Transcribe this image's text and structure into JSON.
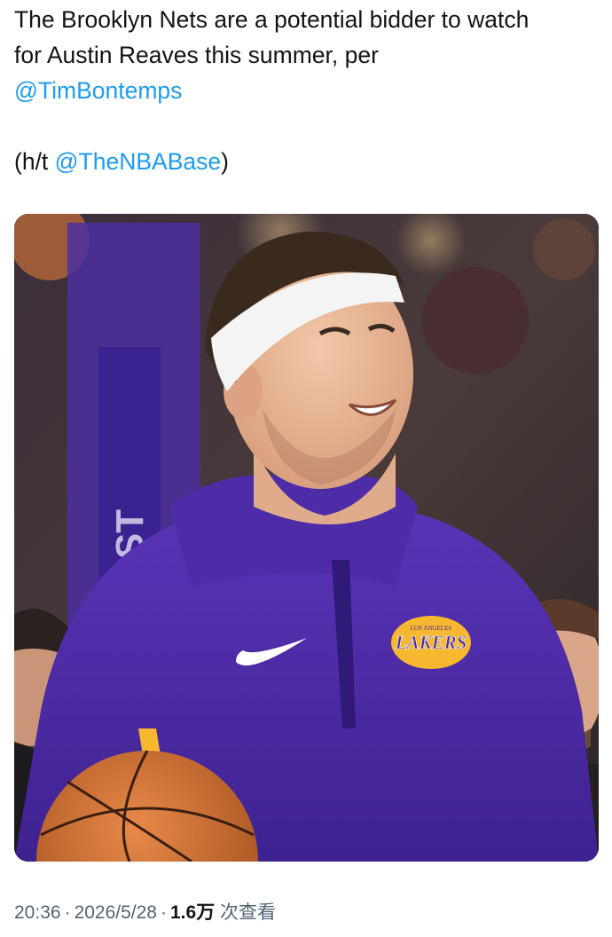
{
  "tweet": {
    "text_line1": "The Brooklyn Nets are a potential bidder to watch",
    "text_line2": "for Austin Reaves this summer, per",
    "mention1": "@TimBontemps",
    "hat_tip_prefix": "(h/t ",
    "mention2": "@TheNBABase",
    "hat_tip_suffix": ")"
  },
  "media": {
    "jersey_logo_text": "LAKERS",
    "jersey_logo_small": "LOS ANGELES",
    "banner_text": "FIRST",
    "colors": {
      "jersey_purple": "#4b2a9e",
      "lakers_gold": "#f5b82e",
      "headband": "#f4f4f4",
      "ball_orange": "#d9762c"
    }
  },
  "meta": {
    "time": "20:36",
    "separator": "·",
    "date": "2026/5/28",
    "views_count": "1.6万",
    "views_label": "次查看"
  }
}
